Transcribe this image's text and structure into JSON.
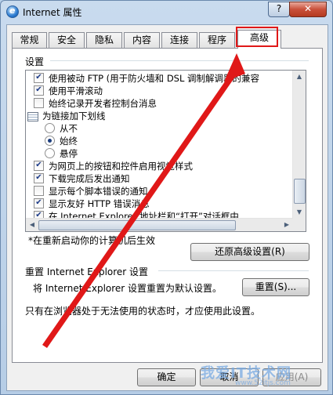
{
  "window": {
    "title": "Internet 属性",
    "app_icon_letter": "e",
    "help_label": "?",
    "close_label": "✕"
  },
  "tabs": [
    {
      "label": "常规"
    },
    {
      "label": "安全"
    },
    {
      "label": "隐私"
    },
    {
      "label": "内容"
    },
    {
      "label": "连接"
    },
    {
      "label": "程序"
    },
    {
      "label": "高级"
    }
  ],
  "active_tab": "高级",
  "settings": {
    "group_label": "设置",
    "items": [
      {
        "type": "checkbox",
        "checked": true,
        "label": "使用被动 FTP (用于防火墙和 DSL 调制解调器的兼容"
      },
      {
        "type": "checkbox",
        "checked": true,
        "label": "使用平滑滚动"
      },
      {
        "type": "checkbox",
        "checked": false,
        "label": "始终记录开发者控制台消息"
      },
      {
        "type": "group",
        "label": "为链接加下划线"
      },
      {
        "type": "radio",
        "checked": false,
        "label": "从不"
      },
      {
        "type": "radio",
        "checked": true,
        "label": "始终"
      },
      {
        "type": "radio",
        "checked": false,
        "label": "悬停"
      },
      {
        "type": "checkbox",
        "checked": true,
        "label": "为网页上的按钮和控件启用视觉样式"
      },
      {
        "type": "checkbox",
        "checked": true,
        "label": "下载完成后发出通知"
      },
      {
        "type": "checkbox",
        "checked": false,
        "label": "显示每个脚本错误的通知"
      },
      {
        "type": "checkbox",
        "checked": true,
        "label": "显示友好 HTTP 错误消息"
      },
      {
        "type": "checkbox",
        "checked": true,
        "label": "在 Internet Explorer 地址栏和“打开”对话框中"
      }
    ],
    "restart_note": "*在重新启动你的计算机后生效",
    "restore_button": "还原高级设置(R)"
  },
  "reset": {
    "heading": "重置 Internet Explorer 设置",
    "description": "将 Internet Explorer 设置重置为默认设置。",
    "button": "重置(S)...",
    "warning": "只有在浏览器处于无法使用的状态时，才应使用此设置。"
  },
  "footer": {
    "ok": "确定",
    "cancel": "取消",
    "apply": "应用(A)"
  },
  "annotation": {
    "highlight_color": "#e01818",
    "arrow_color": "#e01818"
  },
  "watermark": {
    "text": "我爱IT技术网",
    "url": "www.52itjs.com"
  }
}
